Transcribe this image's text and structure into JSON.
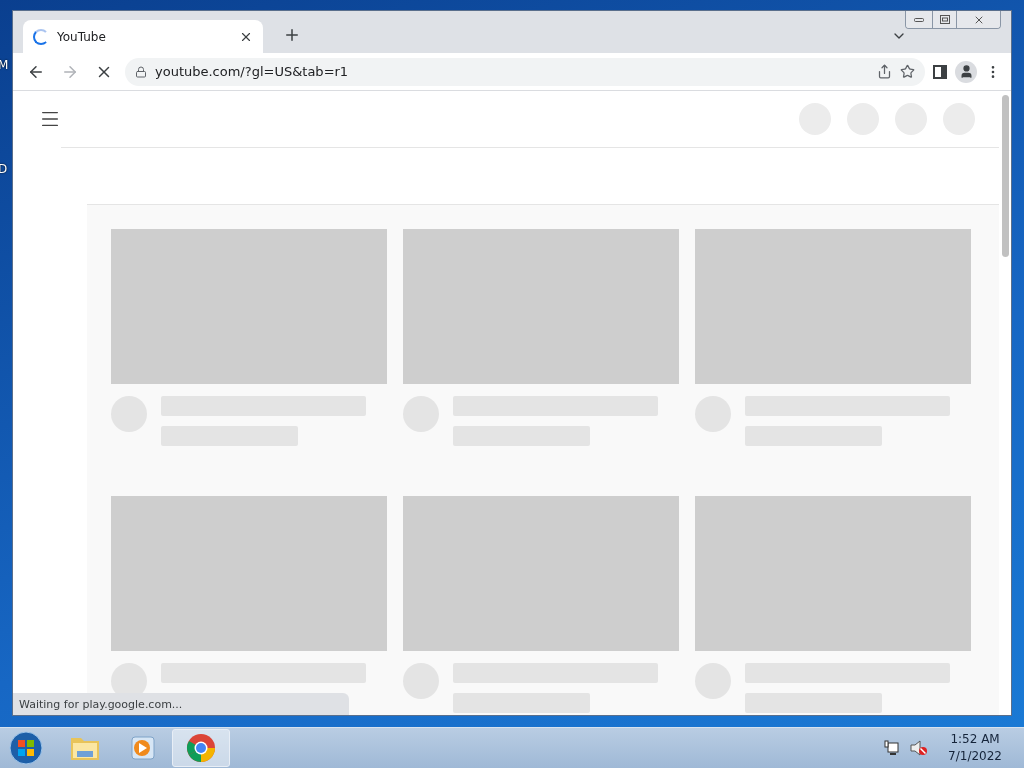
{
  "desktop_labels": [
    "M",
    "D"
  ],
  "browser": {
    "tab": {
      "title": "YouTube",
      "loading": true
    },
    "toolbar": {
      "forward_disabled": true,
      "loading": true
    },
    "url": "youtube.com/?gl=US&tab=r1"
  },
  "status_bubble": "Waiting for play.google.com...",
  "taskbar": {
    "apps": [
      {
        "kind": "explorer",
        "selected": false
      },
      {
        "kind": "media",
        "selected": false
      },
      {
        "kind": "chrome",
        "selected": true
      }
    ]
  },
  "clock": {
    "time": "1:52 AM",
    "date": "7/1/2022"
  }
}
